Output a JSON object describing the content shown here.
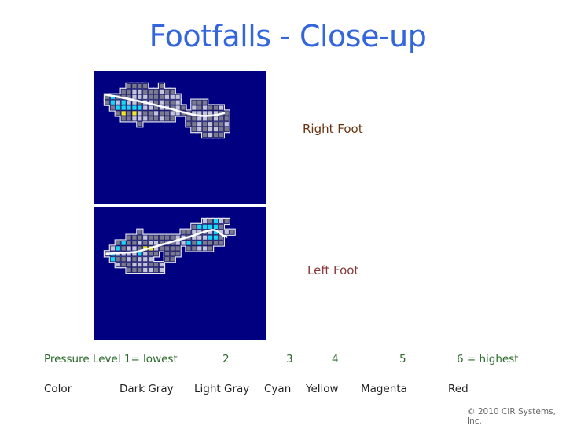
{
  "title": "Footfalls - Close-up",
  "labels": {
    "right_foot": "Right Foot",
    "left_foot": "Left Foot"
  },
  "legend": {
    "level_header": "Pressure Level  1= lowest",
    "color_header": "Color",
    "levels": [
      {
        "level": "1",
        "color_name": "Dark Gray",
        "hex": "#7a7a8c"
      },
      {
        "level": "2",
        "color_name": "Light Gray",
        "hex": "#c4c4d8"
      },
      {
        "level": "3",
        "color_name": "Cyan",
        "hex": "#19d6f5"
      },
      {
        "level": "4",
        "color_name": "Yellow",
        "hex": "#f2e620"
      },
      {
        "level": "5",
        "color_name": "Magenta",
        "hex": "#e020e0"
      },
      {
        "level": "6 =  highest",
        "color_name": "Red",
        "hex": "#e02020"
      }
    ]
  },
  "colors": {
    "background": "#000080",
    "grid_line": "#1a1a70",
    "outline": "#e6e6f0",
    "trace": "#ffffff",
    "D": "#7a7a8c",
    "L": "#c4c4d8",
    "C": "#19d6f5",
    "Y": "#f2e620"
  },
  "footprints": {
    "right": {
      "rows": [
        "....DDDD..D............",
        "...DDLLDDDLDD..........",
        "DCDDDLLLDDDLLL.........",
        "DCLCLLDLLDLDDL..DDD....",
        ".DCCCCCLLDLLDLD.LDLDDL.",
        "..DYDYLDDLDDLLDDLLLLLDD",
        "...DDLLLDDLDD..DDLLDLDD",
        "......D........DDLDLDDL",
        "................DLDLLDD",
        "..................DLDD."
      ],
      "trace": [
        [
          0.3,
          2.1
        ],
        [
          3,
          2.6
        ],
        [
          7,
          3.4
        ],
        [
          11,
          4.4
        ],
        [
          14,
          5.2
        ],
        [
          17,
          6.0
        ],
        [
          20,
          6.0
        ],
        [
          22,
          5.5
        ]
      ]
    },
    "left": {
      "rows": [
        "..................LDCLD..",
        "................DCCCCD...",
        "......D.......DDLLDLCLLD.",
        "....DDDLDDDDDLLDLLLCCD...",
        "..DCDDLDLLDDDLLCDCDDDD...",
        ".LCDLLDYYLDDDD.DDLLD.....",
        "DCLLLLCLDD.DDD...........",
        ".CDDLDLLL..DD............",
        "..LDDLLLDDL..............",
        "....DDDLLDL.............."
      ],
      "trace": [
        [
          0.4,
          6.5
        ],
        [
          3,
          6.3
        ],
        [
          6,
          6.2
        ],
        [
          8,
          5.5
        ],
        [
          10,
          5.0
        ],
        [
          13,
          4.1
        ],
        [
          16,
          3.3
        ],
        [
          19,
          2.2
        ],
        [
          20.5,
          2.0
        ],
        [
          21.5,
          3.0
        ],
        [
          22.5,
          3.4
        ]
      ]
    }
  },
  "copyright": "© 2010 CIR Systems, Inc."
}
